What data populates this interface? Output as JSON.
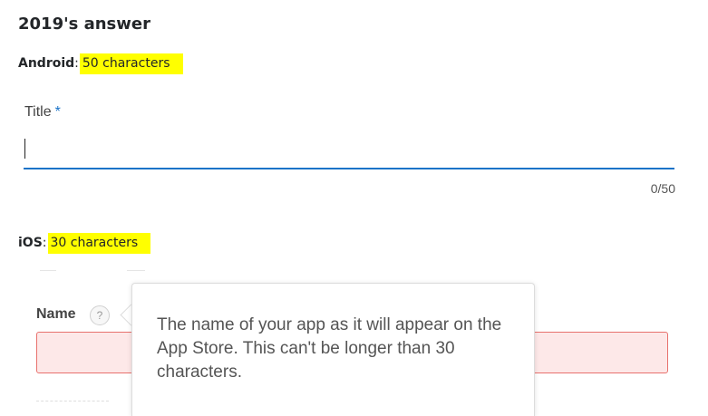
{
  "heading": "2019's answer",
  "android": {
    "label": "Android",
    "value": "50 characters",
    "field_label": "Title",
    "required_mark": "*",
    "counter": "0/50",
    "accent_color": "#1a73c8"
  },
  "ios": {
    "label": "iOS",
    "value": "30 characters",
    "field_label": "Name",
    "help_icon_glyph": "?",
    "tooltip": "The name of your app as it will appear on the App Store. This can't be longer than 30 characters.",
    "error_border_color": "#e8716d",
    "error_fill_color": "#fde8e8"
  },
  "highlight_color": "#ffff00"
}
